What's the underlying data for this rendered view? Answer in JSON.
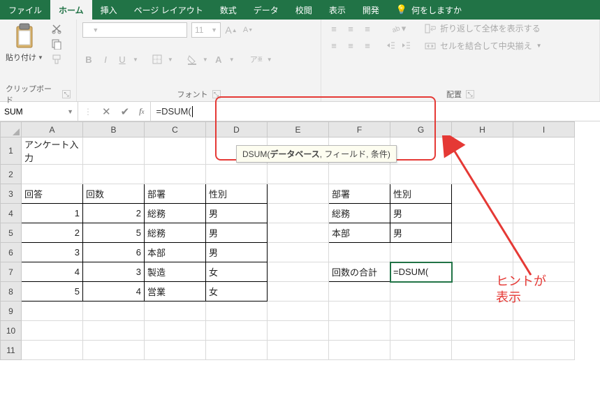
{
  "menu": {
    "tabs": [
      "ファイル",
      "ホーム",
      "挿入",
      "ページ レイアウト",
      "数式",
      "データ",
      "校閲",
      "表示",
      "開発"
    ],
    "active_index": 1,
    "tell_me": "何をしますか"
  },
  "ribbon": {
    "clipboard": {
      "paste": "貼り付け",
      "label": "クリップボード"
    },
    "font": {
      "size": "11",
      "label": "フォント",
      "bold": "B",
      "italic": "I",
      "underline": "U"
    },
    "alignment": {
      "label": "配置",
      "wrap": "折り返して全体を表示する",
      "merge": "セルを結合して中央揃え"
    }
  },
  "formula_bar": {
    "name_box": "SUM",
    "formula": "=DSUM(",
    "tooltip_fn": "DSUM(",
    "tooltip_bold": "データベース",
    "tooltip_rest": ", フィールド, 条件)"
  },
  "sheet": {
    "columns": [
      "A",
      "B",
      "C",
      "D",
      "E",
      "F",
      "G",
      "H",
      "I"
    ],
    "rows_shown": 11,
    "active_cell": "G7",
    "data": {
      "A1": "アンケート入力",
      "A3": "回答",
      "B3": "回数",
      "C3": "部署",
      "D3": "性別",
      "A4": "1",
      "B4": "2",
      "C4": "総務",
      "D4": "男",
      "A5": "2",
      "B5": "5",
      "C5": "総務",
      "D5": "男",
      "A6": "3",
      "B6": "6",
      "C6": "本部",
      "D6": "男",
      "A7": "4",
      "B7": "3",
      "C7": "製造",
      "D7": "女",
      "A8": "5",
      "B8": "4",
      "C8": "営業",
      "D8": "女",
      "F3": "部署",
      "G3": "性別",
      "F4": "総務",
      "G4": "男",
      "F5": "本部",
      "G5": "男",
      "F7": "回数の合計",
      "G7": "=DSUM("
    },
    "numeric_cells": [
      "A4",
      "B4",
      "A5",
      "B5",
      "A6",
      "B6",
      "A7",
      "B7",
      "A8",
      "B8"
    ],
    "bordered_cells": [
      "A3",
      "B3",
      "C3",
      "D3",
      "A4",
      "B4",
      "C4",
      "D4",
      "A5",
      "B5",
      "C5",
      "D5",
      "A6",
      "B6",
      "C6",
      "D6",
      "A7",
      "B7",
      "C7",
      "D7",
      "A8",
      "B8",
      "C8",
      "D8",
      "F3",
      "G3",
      "F4",
      "G4",
      "F5",
      "G5",
      "F7",
      "G7"
    ]
  },
  "annotation": {
    "text_line1": "ヒントが",
    "text_line2": "表示"
  }
}
